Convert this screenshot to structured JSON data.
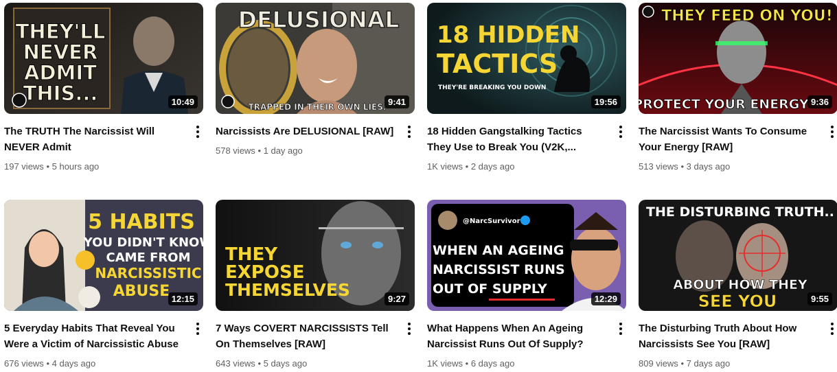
{
  "videos": [
    {
      "title": "The TRUTH The Narcissist Will NEVER Admit",
      "views": "197 views",
      "age": "5 hours ago",
      "duration": "10:49",
      "thumb_lines": [
        "THEY'LL",
        "NEVER",
        "ADMIT",
        "THIS..."
      ]
    },
    {
      "title": "Narcissists Are DELUSIONAL [RAW]",
      "views": "578 views",
      "age": "1 day ago",
      "duration": "9:41",
      "thumb_lines": [
        "DELUSIONAL",
        "TRAPPED IN THEIR OWN LIES."
      ]
    },
    {
      "title": "18 Hidden Gangstalking Tactics They Use to Break You (V2K,...",
      "views": "1K views",
      "age": "2 days ago",
      "duration": "19:56",
      "thumb_lines": [
        "18 HIDDEN",
        "TACTICS",
        "THEY'RE BREAKING YOU DOWN"
      ]
    },
    {
      "title": "The Narcissist Wants To Consume Your Energy [RAW]",
      "views": "513 views",
      "age": "3 days ago",
      "duration": "9:36",
      "thumb_lines": [
        "THEY FEED ON YOU!",
        "PROTECT YOUR ENERGY"
      ]
    },
    {
      "title": "5 Everyday Habits That Reveal You Were a Victim of Narcissistic Abuse",
      "views": "676 views",
      "age": "4 days ago",
      "duration": "12:15",
      "thumb_lines": [
        "5 HABITS",
        "YOU DIDN'T KNOW",
        "CAME FROM",
        "NARCISSISTIC",
        "ABUSE"
      ]
    },
    {
      "title": "7 Ways COVERT NARCISSISTS Tell On Themselves [RAW]",
      "views": "643 views",
      "age": "5 days ago",
      "duration": "9:27",
      "thumb_lines": [
        "THEY",
        "EXPOSE",
        "THEMSELVES"
      ]
    },
    {
      "title": "What Happens When An Ageing Narcissist Runs Out Of Supply?",
      "views": "1K views",
      "age": "6 days ago",
      "duration": "12:29",
      "thumb_lines": [
        "@NarcSurvivor",
        "WHEN AN AGEING",
        "NARCISSIST RUNS",
        "OUT OF SUPPLY"
      ]
    },
    {
      "title": "The Disturbing Truth About How Narcissists See You [RAW]",
      "views": "809 views",
      "age": "7 days ago",
      "duration": "9:55",
      "thumb_lines": [
        "THE DISTURBING TRUTH..",
        "ABOUT HOW THEY",
        "SEE YOU"
      ]
    }
  ],
  "separator": "•",
  "colors": {
    "yellow": "#f5d634",
    "red": "#e62d2d",
    "title": "#0f0f0f",
    "meta": "#606060"
  }
}
